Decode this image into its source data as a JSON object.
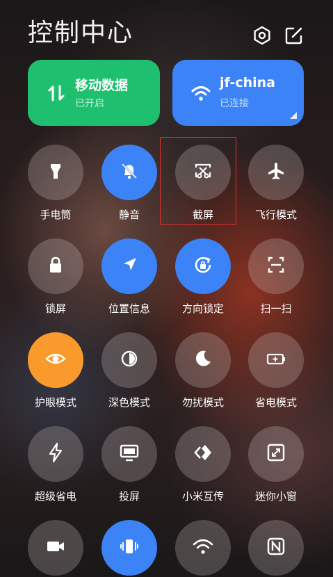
{
  "header": {
    "title": "控制中心"
  },
  "tiles": {
    "mobile_data": {
      "name": "移动数据",
      "status": "已开启",
      "icon": "mobile-data-arrows-icon",
      "color": "#1ec06f"
    },
    "wifi": {
      "name": "jf-china",
      "status": "已连接",
      "icon": "wifi-icon",
      "color": "#3b83f6"
    }
  },
  "toggles": {
    "flashlight": {
      "label": "手电筒",
      "icon": "flashlight-icon",
      "active": false
    },
    "mute": {
      "label": "静音",
      "icon": "bell-off-icon",
      "active": true
    },
    "screenshot": {
      "label": "截屏",
      "icon": "screenshot-scissors-icon",
      "active": false
    },
    "airplane": {
      "label": "飞行模式",
      "icon": "airplane-icon",
      "active": false
    },
    "lock": {
      "label": "锁屏",
      "icon": "lock-icon",
      "active": false
    },
    "location": {
      "label": "位置信息",
      "icon": "location-arrow-icon",
      "active": true
    },
    "rotation_lock": {
      "label": "方向锁定",
      "icon": "rotation-lock-icon",
      "active": true
    },
    "scan": {
      "label": "扫一扫",
      "icon": "scan-icon",
      "active": false
    },
    "eye_care": {
      "label": "护眼模式",
      "icon": "eye-icon",
      "active": true
    },
    "dark_mode": {
      "label": "深色模式",
      "icon": "contrast-icon",
      "active": false
    },
    "dnd": {
      "label": "勿扰模式",
      "icon": "moon-icon",
      "active": false
    },
    "battery_saver": {
      "label": "省电模式",
      "icon": "battery-icon",
      "active": false
    },
    "ultra_saver": {
      "label": "超级省电",
      "icon": "lightning-icon",
      "active": false
    },
    "cast": {
      "label": "投屏",
      "icon": "monitor-icon",
      "active": false
    },
    "mi_share": {
      "label": "小米互传",
      "icon": "mi-share-icon",
      "active": false
    },
    "mini_window": {
      "label": "迷你小窗",
      "icon": "mini-window-icon",
      "active": false
    },
    "video": {
      "icon": "video-camera-icon",
      "active": false
    },
    "vibrate": {
      "icon": "vibrate-icon",
      "active": true
    },
    "hotspot": {
      "icon": "wifi-hotspot-icon",
      "active": false
    },
    "nfc": {
      "icon": "nfc-icon",
      "active": false
    }
  },
  "colors": {
    "active_blue": "#3b83f6",
    "eye_care_orange": "#fb9a2c",
    "highlight_red": "#e0302a"
  }
}
